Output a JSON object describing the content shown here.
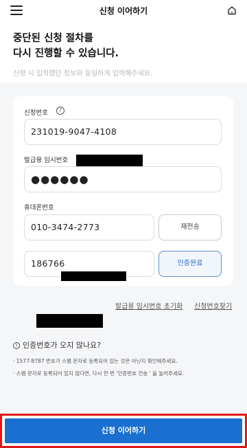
{
  "header": {
    "title": "신청 이어하기",
    "menu_icon": "hamburger-menu-icon",
    "home_icon": "home-icon"
  },
  "intro": {
    "headline_line1": "중단된 신청 절차를",
    "headline_line2": "다시 진행할 수 있습니다.",
    "subline": "신청 시 입력했던 정보와 동일하게 입력해주세요."
  },
  "form": {
    "application_number_label": "신청번호",
    "help_icon": "question-circle-icon",
    "application_number_value": "231019-9047-4108",
    "temp_password_label": "발급용 임시번호",
    "temp_password_value": "●●●●●●",
    "phone_label": "휴대폰번호",
    "phone_value": "010-3474-2773",
    "resend_button": "재전송",
    "auth_code_value": "186766",
    "verified_button": "인증완료"
  },
  "links": {
    "reset_temp_password": "발급용 임시번호 초기화",
    "find_application_number": "신청번호찾기"
  },
  "notice": {
    "info_icon": "info-circle-icon",
    "title": "인증번호가 오지 않나요?",
    "line1": "· 1577-8787 번호가 스팸 문자로 등록되어 있는 것은 아닌지 확인해주세요.",
    "line2": "· 스팸 문자로 등록되어 있지 않다면, 다시 한 번 '인증번호 전송 ' 을 눌러주세요."
  },
  "footer": {
    "continue_button": "신청 이어하기"
  },
  "colors": {
    "accent": "#1a6fd1",
    "highlight_border": "#e01818",
    "verified_text": "#2f6cc2"
  }
}
